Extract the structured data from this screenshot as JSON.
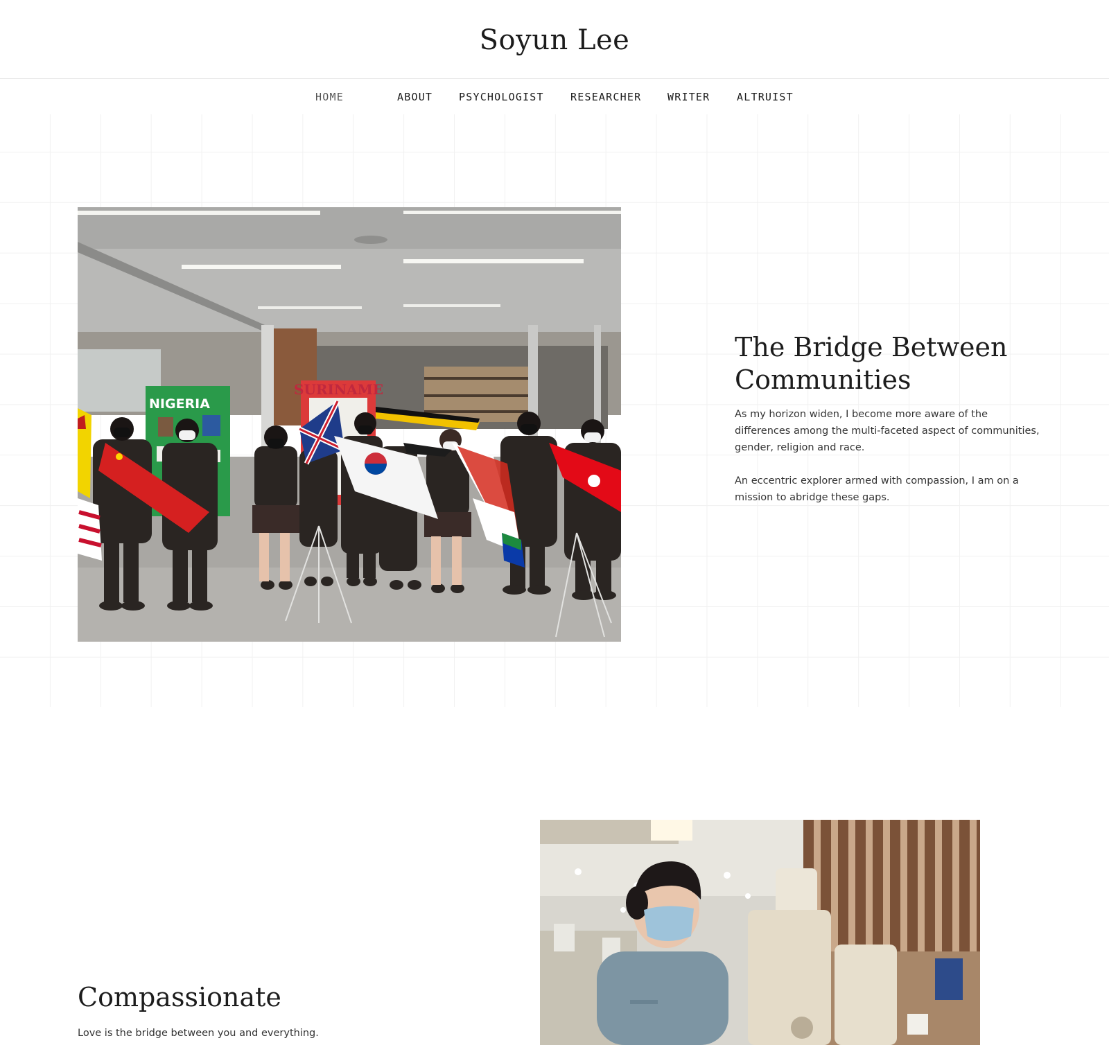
{
  "site": {
    "title": "Soyun Lee"
  },
  "nav": {
    "items": [
      {
        "label": "HOME",
        "active": true
      },
      {
        "label": "ABOUT",
        "active": false
      },
      {
        "label": "PSYCHOLOGIST",
        "active": false
      },
      {
        "label": "RESEARCHER",
        "active": false
      },
      {
        "label": "WRITER",
        "active": false
      },
      {
        "label": "ALTRUIST",
        "active": false
      }
    ]
  },
  "section1": {
    "heading": "The Bridge Between Communities",
    "paragraphs": [
      "As my horizon widen, I become more aware of the differences among the multi-faceted aspect of communities, gender, religion and race.",
      "An eccentric explorer armed with compassion, I am on a mission to abridge these gaps."
    ],
    "image_sign_text": [
      "NIGERIA",
      "SURINAME"
    ]
  },
  "section2": {
    "heading": "Compassionate",
    "paragraph": "Love is the bridge between you and everything."
  },
  "colors": {
    "background": "#ffffff",
    "text": "#1c1c1c",
    "grid": "#f1f1f1"
  }
}
